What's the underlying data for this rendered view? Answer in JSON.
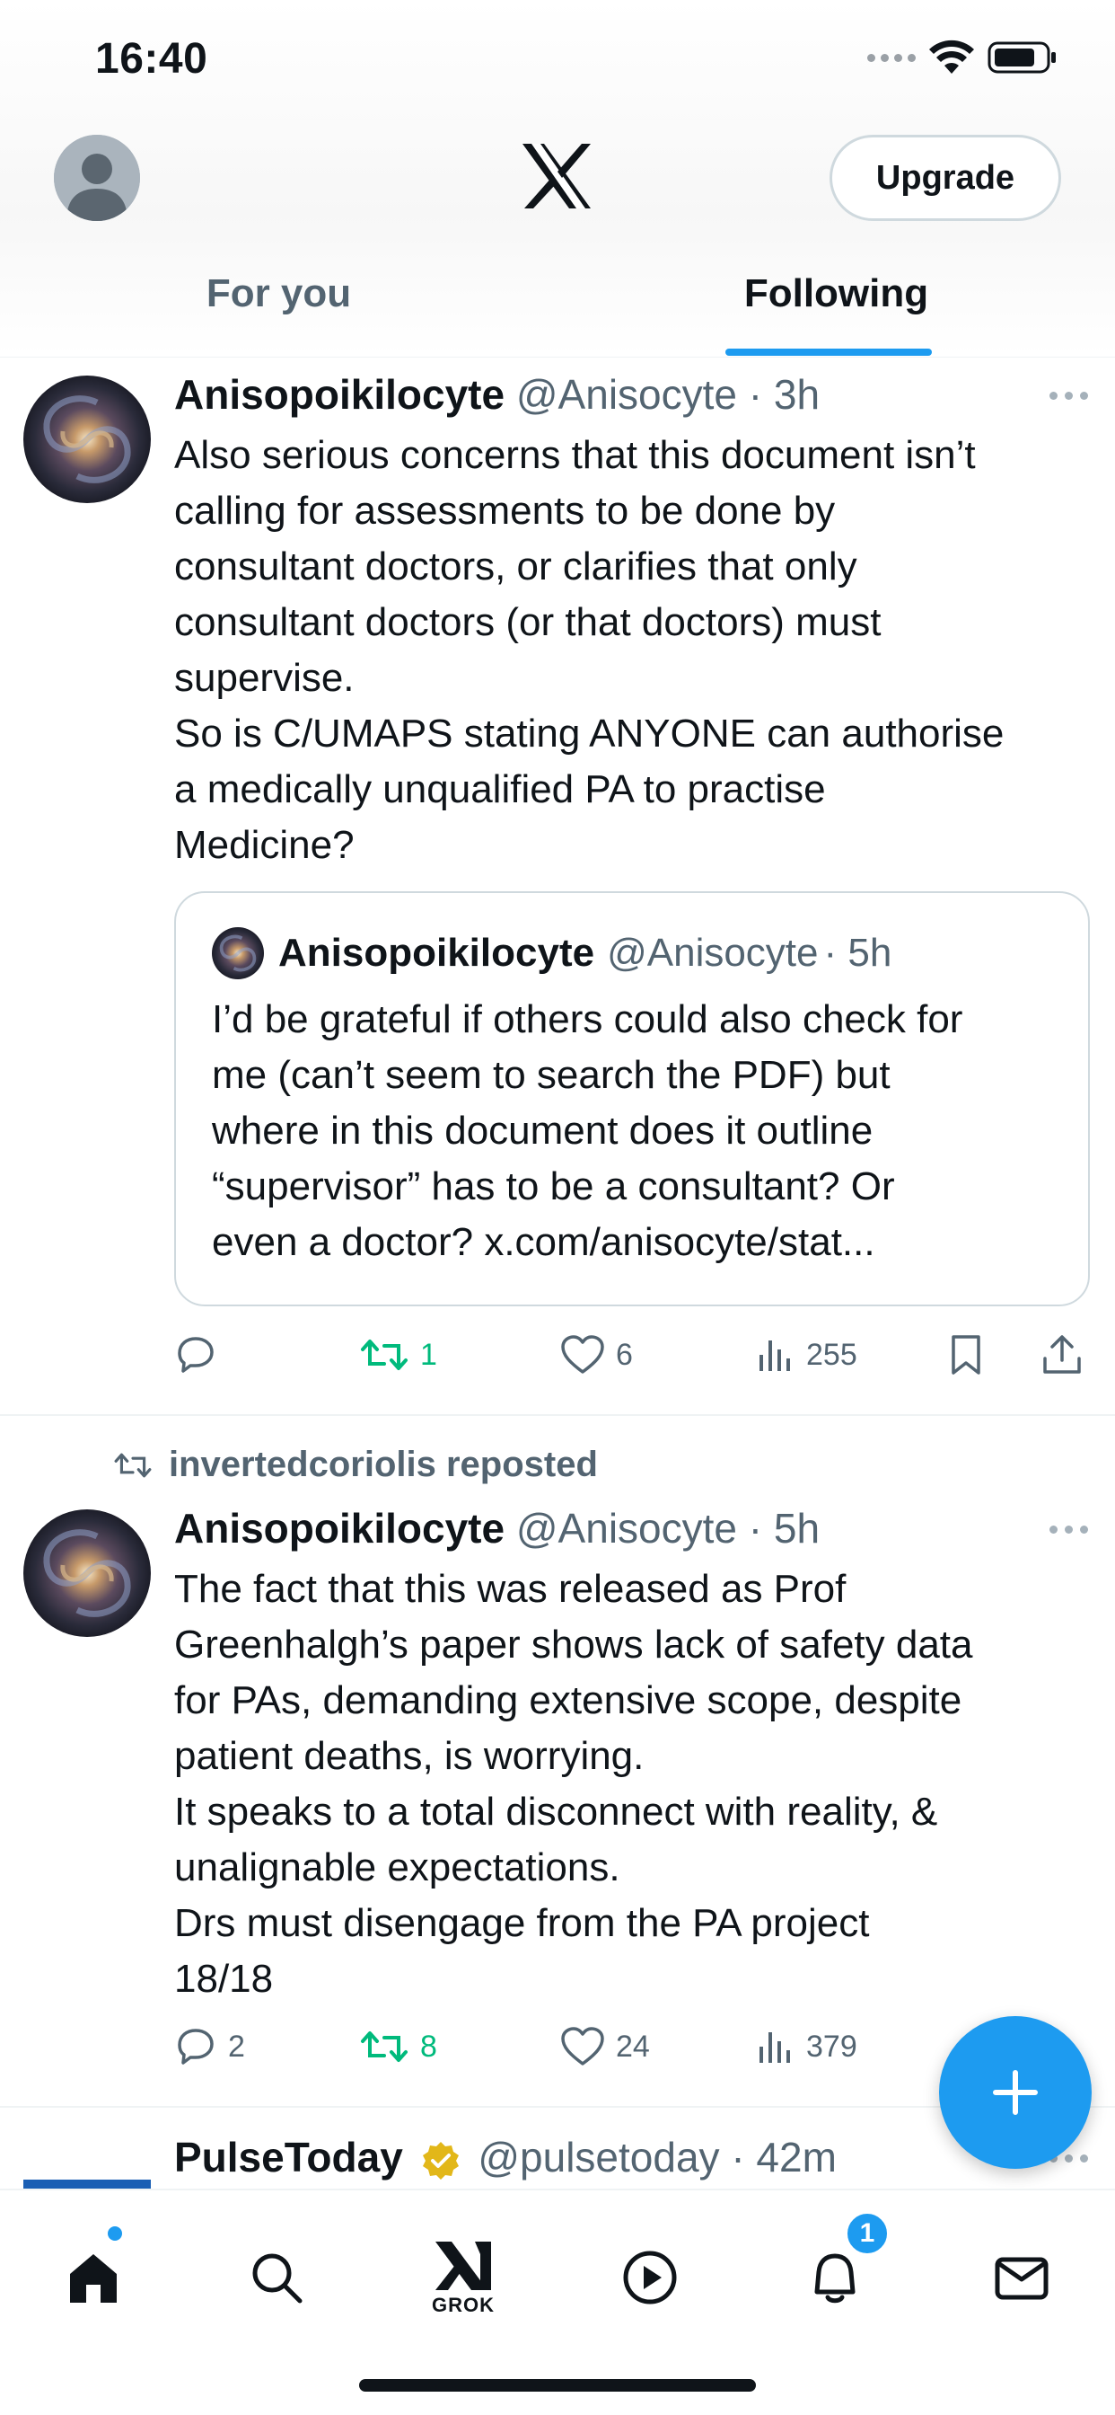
{
  "status_bar": {
    "time": "16:40"
  },
  "header": {
    "upgrade_label": "Upgrade",
    "tabs": [
      {
        "label": "For you",
        "active": false
      },
      {
        "label": "Following",
        "active": true
      }
    ]
  },
  "posts": [
    {
      "name": "Anisopoikilocyte",
      "handle": "@Anisocyte",
      "time": "· 3h",
      "text_lines": [
        "Also serious concerns that this document isn’t",
        "calling for assessments to be done by",
        "consultant doctors, or clarifies that only",
        "consultant doctors (or that doctors) must",
        "supervise.",
        "So is C/UMAPS stating ANYONE can authorise",
        "a medically unqualified PA to practise",
        "Medicine?"
      ],
      "quote": {
        "name": "Anisopoikilocyte",
        "handle": "@Anisocyte",
        "time": "· 5h",
        "text_lines": [
          "I’d be grateful if others could also check for",
          "me (can’t seem to search the PDF) but",
          "where in this document does it outline",
          "“supervisor” has to be a consultant? Or",
          "even a doctor? x.com/anisocyte/stat..."
        ]
      },
      "stats": {
        "replies": "",
        "reposts": "1",
        "likes": "6",
        "views": "255"
      }
    },
    {
      "repost_label": "invertedcoriolis reposted",
      "name": "Anisopoikilocyte",
      "handle": "@Anisocyte",
      "time": "· 5h",
      "text_lines": [
        "The fact that this was released as Prof",
        "Greenhalgh’s paper shows lack of safety data",
        "for PAs, demanding extensive scope, despite",
        "patient deaths, is worrying.",
        "It speaks to a total disconnect with reality, &",
        "unalignable expectations.",
        "Drs must disengage from the PA project",
        "18/18"
      ],
      "stats": {
        "replies": "2",
        "reposts": "8",
        "likes": "24",
        "views": "379"
      }
    },
    {
      "name": "PulseToday",
      "handle": "@pulsetoday",
      "time": "· 42m"
    }
  ],
  "bottom_nav": {
    "grok_label": "GROK",
    "notifications_badge": "1"
  },
  "colors": {
    "accent": "#1d9bf0",
    "repost_green": "#00ba7c",
    "secondary_text": "#536471",
    "verified_gold": "#e2b719"
  }
}
